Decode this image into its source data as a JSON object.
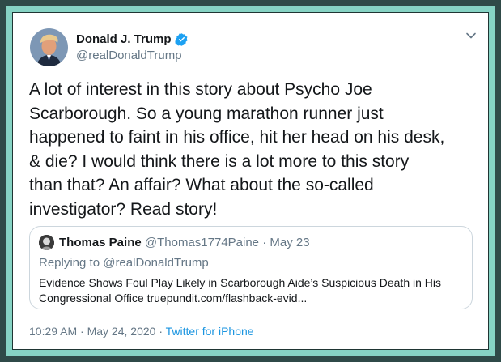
{
  "tweet": {
    "author": {
      "name": "Donald J. Trump",
      "handle": "@realDonaldTrump",
      "verified": true
    },
    "text": "A lot of interest in this story about Psycho Joe\nScarborough. So a young marathon runner just\nhappened to faint in his office, hit her head on his desk,\n& die? I would think there is a lot more to this story\nthan that? An affair? What about the so-called\ninvestigator? Read story!",
    "timestamp": "10:29 AM · May 24, 2020",
    "separator": " · ",
    "source": "Twitter for iPhone"
  },
  "quote": {
    "name": "Thomas Paine",
    "meta": "@Thomas1774Paine · May 23",
    "replying_to": "Replying to @realDonaldTrump",
    "text": "Evidence Shows Foul Play Likely in Scarborough Aide’s Suspicious Death in His\nCongressional Office truepundit.com/flashback-evid..."
  },
  "colors": {
    "frame_dark": "#2f4a48",
    "frame_accent": "#86d3c4",
    "text_primary": "#14171a",
    "text_secondary": "#657786",
    "link": "#1b95e0",
    "verified": "#1da1f2"
  },
  "icons": [
    "verified-badge-icon",
    "chevron-down-icon"
  ]
}
